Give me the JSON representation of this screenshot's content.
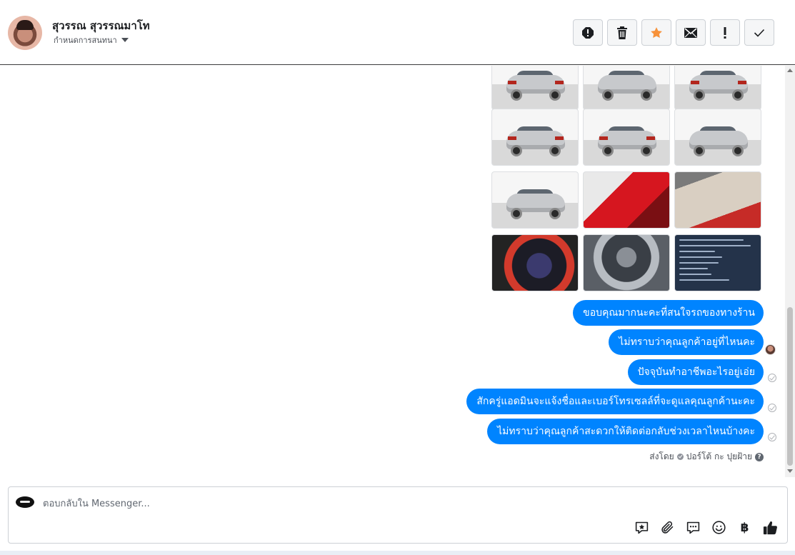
{
  "header": {
    "contact_name": "สุวรรณ สุวรรณมาโท",
    "conversation_label": "กำหนดการสนทนา"
  },
  "toolbar": {
    "icons": [
      "spam-icon",
      "trash-icon",
      "star-icon",
      "mail-icon",
      "exclamation-icon",
      "check-icon"
    ],
    "star_color": "#f7923a"
  },
  "messages": [
    {
      "text": "ขอบคุณมากนะคะที่สนใจรถของทางร้าน"
    },
    {
      "text": "ไม่ทราบว่าคุณลูกค้าอยู่ที่ไหนคะ"
    },
    {
      "text": "ปัจจุบันทำอาชีพอะไรอยู่เอ่ย"
    },
    {
      "text": "สักครู่แอดมินจะแจ้งชื่อและเบอร์โทรเซลล์ที่จะดูแลคุณลูกค้านะคะ"
    },
    {
      "text": "ไม่ทราบว่าคุณลูกค้าสะดวกให้ติดต่อกลับช่วงเวลาไหนบ้างคะ"
    }
  ],
  "sent_by": {
    "prefix": "ส่งโดย",
    "name": "ปอร์โต้ กะ ปุยฝ้าย"
  },
  "composer": {
    "placeholder": "ตอบกลับใน Messenger...",
    "baht_symbol": "฿"
  },
  "colors": {
    "bubble": "#0084ff",
    "accent_star": "#f7923a"
  }
}
